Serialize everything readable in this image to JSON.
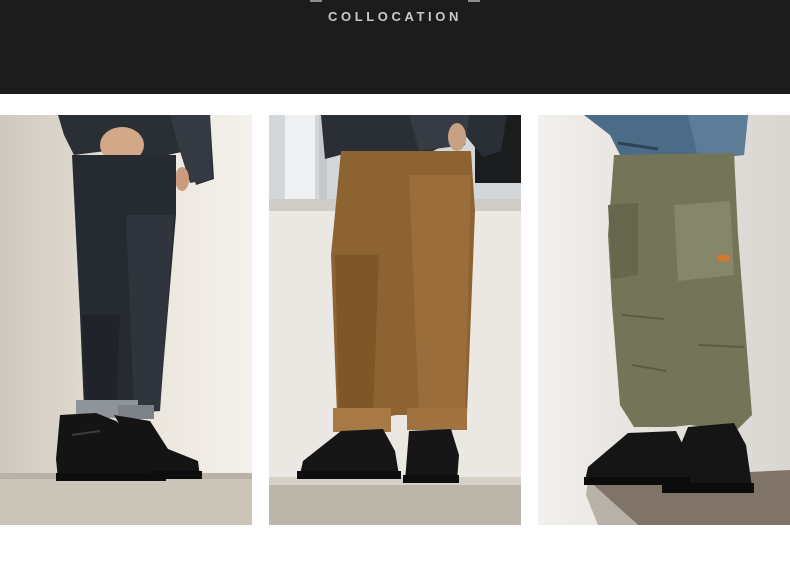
{
  "header": {
    "title": "COLLOCATION"
  },
  "photos": [
    {
      "subject": "black-jeans-boots-photo",
      "pants_color": "#262a31",
      "boot_color": "#141414"
    },
    {
      "subject": "corduroy-pants-boots-photo",
      "pants_color": "#8e6332",
      "boot_color": "#161616"
    },
    {
      "subject": "cargo-pants-boots-photo",
      "pants_color": "#737458",
      "boot_color": "#151515"
    }
  ]
}
